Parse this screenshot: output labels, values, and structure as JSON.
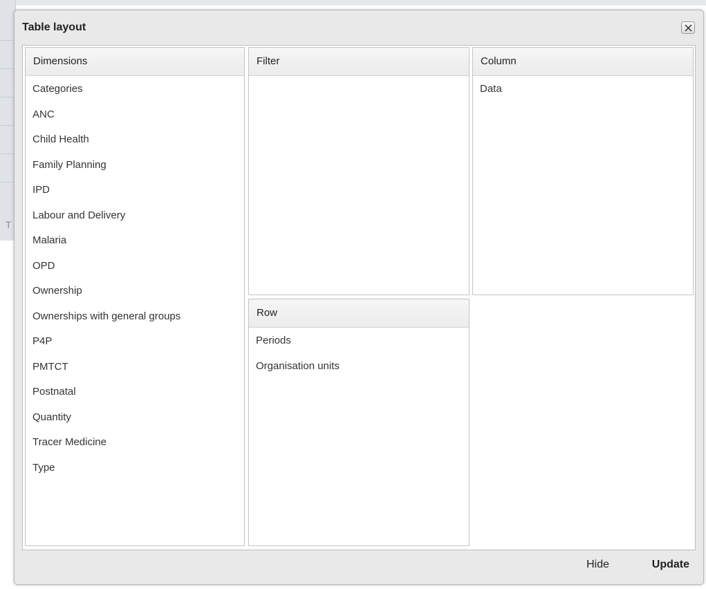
{
  "dialog": {
    "title": "Table layout",
    "close_icon": "close-icon"
  },
  "background": {
    "partial_text": "T"
  },
  "panels": {
    "dimensions": {
      "header": "Dimensions",
      "items": [
        "Categories",
        "ANC",
        "Child Health",
        "Family Planning",
        "IPD",
        "Labour and Delivery",
        "Malaria",
        "OPD",
        "Ownership",
        "Ownerships with general groups",
        "P4P",
        "PMTCT",
        "Postnatal",
        "Quantity",
        "Tracer Medicine",
        "Type"
      ]
    },
    "filter": {
      "header": "Filter",
      "items": []
    },
    "column": {
      "header": "Column",
      "items": [
        "Data"
      ]
    },
    "row": {
      "header": "Row",
      "items": [
        "Periods",
        "Organisation units"
      ]
    }
  },
  "footer": {
    "hide_label": "Hide",
    "update_label": "Update"
  }
}
